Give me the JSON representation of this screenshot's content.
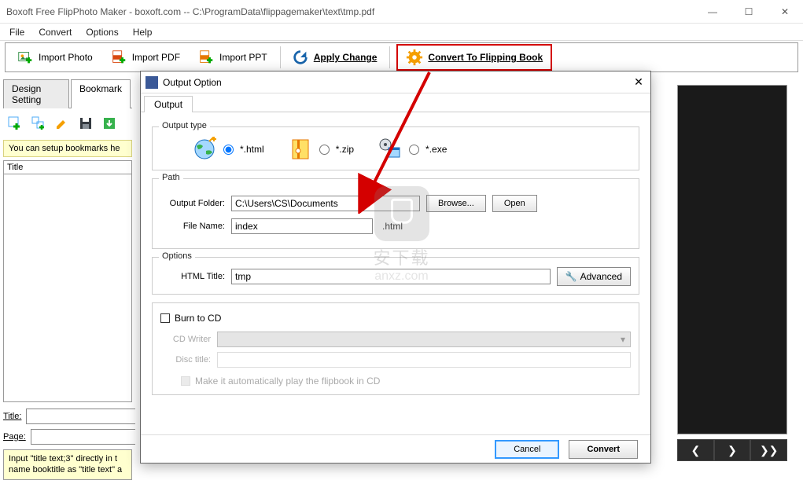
{
  "window": {
    "title": "Boxoft Free FlipPhoto Maker - boxoft.com -- C:\\ProgramData\\flippagemaker\\text\\tmp.pdf",
    "min": "—",
    "max": "☐",
    "close": "✕"
  },
  "menu": {
    "file": "File",
    "convert": "Convert",
    "options": "Options",
    "help": "Help"
  },
  "toolbar": {
    "import_photo": "Import Photo",
    "import_pdf": "Import PDF",
    "import_ppt": "Import PPT",
    "apply_change": "Apply Change",
    "convert_flip": "Convert To Flipping Book"
  },
  "tabs": {
    "design_setting": "Design Setting",
    "bookmark": "Bookmark"
  },
  "sidebar": {
    "setup_msg": "You can setup bookmarks he",
    "title_header": "Title",
    "title_label": "Title:",
    "page_label": "Page:",
    "title_value": "",
    "page_value": "",
    "hint": "Input \"title text;3\" directly in t\nname booktitle as \"title text\" a"
  },
  "dialog": {
    "title": "Output Option",
    "tab": "Output",
    "output_type_legend": "Output type",
    "opt_html": "*.html",
    "opt_zip": "*.zip",
    "opt_exe": "*.exe",
    "path_legend": "Path",
    "output_folder_label": "Output Folder:",
    "output_folder_value": "C:\\Users\\CS\\Documents",
    "browse": "Browse...",
    "open": "Open",
    "file_name_label": "File Name:",
    "file_name_value": "index",
    "file_suffix": ".html",
    "options_legend": "Options",
    "html_title_label": "HTML Title:",
    "html_title_value": "tmp",
    "advanced": "Advanced",
    "burn_label": "Burn to CD",
    "cd_writer_label": "CD Writer",
    "disc_title_label": "Disc title:",
    "make_auto": "Make it automatically play the flipbook in CD",
    "cancel": "Cancel",
    "convert": "Convert"
  },
  "preview_nav": {
    "prev": "❮",
    "next": "❯",
    "fast": "❯❯"
  },
  "watermark": {
    "big": "安下载",
    "small": "anxz.com"
  }
}
